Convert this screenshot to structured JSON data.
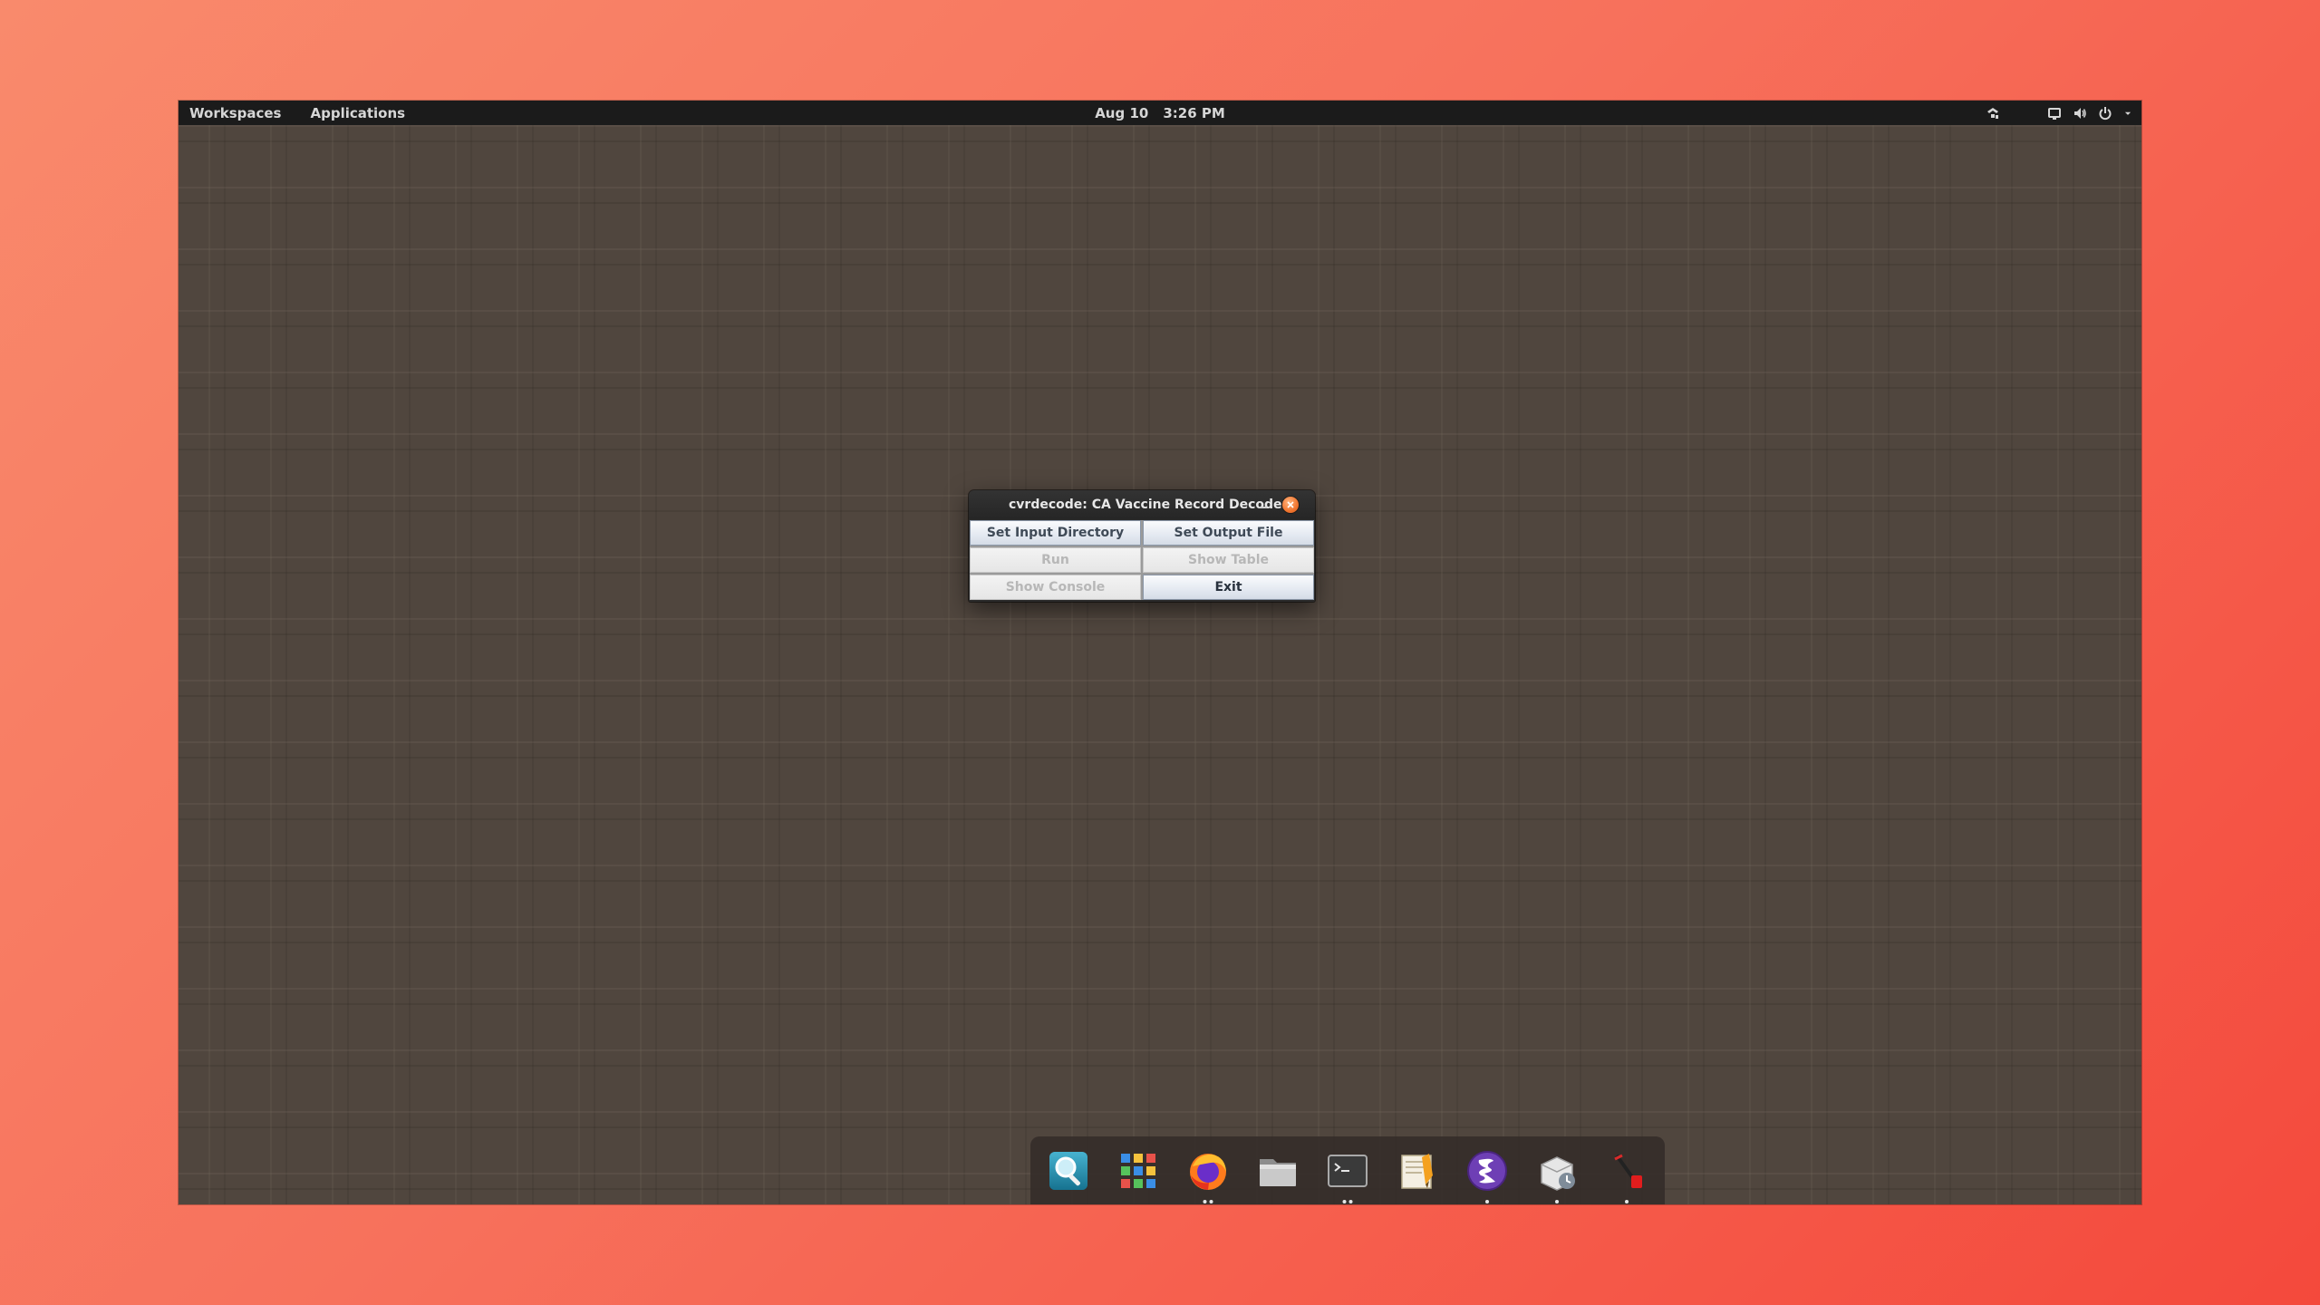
{
  "top_panel": {
    "workspaces_label": "Workspaces",
    "applications_label": "Applications",
    "date": "Aug 10",
    "time": "3:26 PM",
    "tray_icons": [
      "network-icon",
      "display-icon",
      "volume-icon",
      "power-icon",
      "dropdown-arrow-icon"
    ]
  },
  "dialog": {
    "title": "cvrdecode: CA Vaccine Record Decoder",
    "buttons": {
      "set_input_directory": "Set Input Directory",
      "set_output_file": "Set Output File",
      "run": "Run",
      "show_table": "Show Table",
      "show_console": "Show Console",
      "exit": "Exit"
    }
  },
  "dock": {
    "items": [
      {
        "icon": "magnifier-icon",
        "running": 0
      },
      {
        "icon": "app-grid-icon",
        "running": 0
      },
      {
        "icon": "firefox-icon",
        "running": 2
      },
      {
        "icon": "file-manager-icon",
        "running": 0
      },
      {
        "icon": "terminal-icon",
        "running": 2
      },
      {
        "icon": "text-editor-icon",
        "running": 0
      },
      {
        "icon": "emacs-icon",
        "running": 1
      },
      {
        "icon": "package-update-icon",
        "running": 1
      },
      {
        "icon": "java-app-icon",
        "running": 1
      }
    ]
  },
  "colors": {
    "wallpaper": "#50463e",
    "panel": "#1b1b1b",
    "dialog_close": "#f0752f",
    "background_gradient_start": "#f98a6c",
    "background_gradient_end": "#f4493c"
  }
}
